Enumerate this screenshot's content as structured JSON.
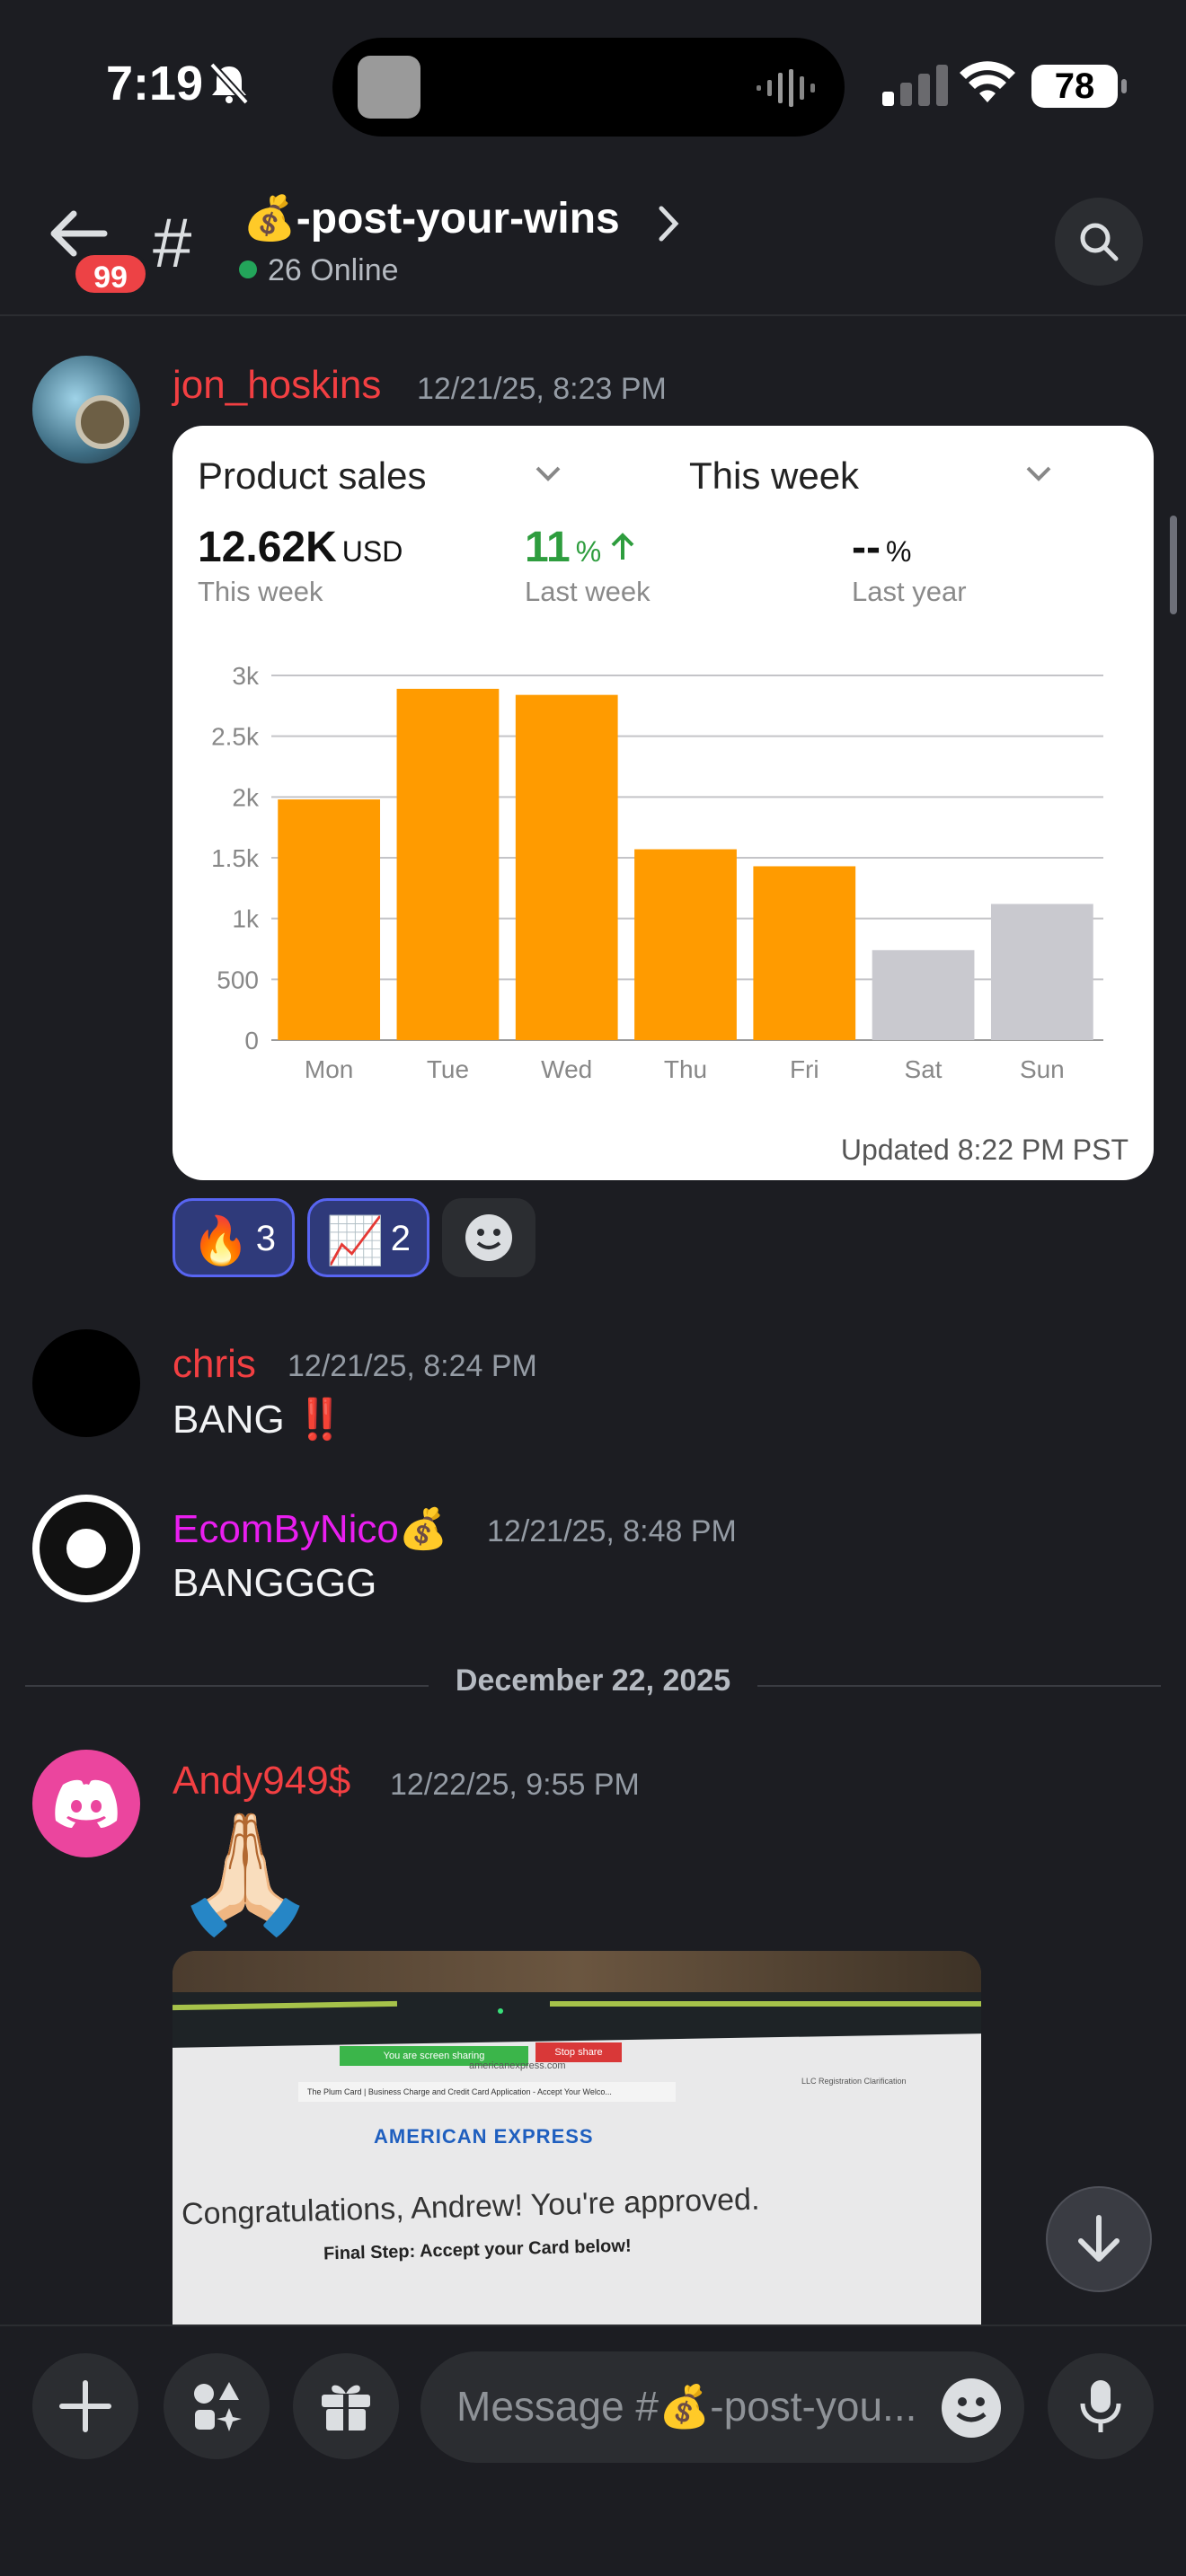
{
  "status_bar": {
    "time": "7:19",
    "battery": "78"
  },
  "header": {
    "back_badge": "99",
    "channel_name": "💰-post-your-wins",
    "online_text": "26 Online"
  },
  "messages": [
    {
      "author": "jon_hoskins",
      "author_color": "#f23f42",
      "timestamp": "12/21/25, 8:23 PM",
      "card": {
        "dropdown_metric": "Product sales",
        "dropdown_period": "This week",
        "kpis": [
          {
            "value": "12.62K",
            "unit": "USD",
            "label": "This week"
          },
          {
            "value": "11",
            "unit": "%",
            "label": "Last week",
            "trend": "up"
          },
          {
            "value": "--",
            "unit": "%",
            "label": "Last year"
          }
        ],
        "updated": "Updated 8:22 PM PST"
      },
      "reactions": [
        {
          "emoji": "🔥",
          "count": "3"
        },
        {
          "emoji": "📈",
          "count": "2"
        }
      ]
    },
    {
      "author": "chris",
      "author_color": "#f23f42",
      "timestamp": "12/21/25, 8:24 PM",
      "text": "BANG ‼️"
    },
    {
      "author": "EcomByNico💰",
      "author_color": "#e91ef0",
      "timestamp": "12/21/25, 8:48 PM",
      "text": "BANGGGG"
    },
    {
      "author": "Andy949$",
      "author_color": "#f23f42",
      "timestamp": "12/22/25, 9:55 PM",
      "text": "🙏🏻",
      "photo": {
        "share_bar": "You are screen sharing",
        "stop_share": "Stop share",
        "url": "americanexpress.com",
        "tab_title": "The Plum Card | Business Charge and Credit Card Application - Accept Your Welco...",
        "tab2_title": "LLC Registration Clarification",
        "brand": "AMERICAN EXPRESS",
        "headline": "Congratulations, Andrew! You're approved.",
        "subline": "Final Step: Accept your Card below!"
      }
    }
  ],
  "date_divider": "December 22, 2025",
  "composer": {
    "placeholder": "Message #💰-post-you..."
  },
  "chart_data": {
    "type": "bar",
    "categories": [
      "Mon",
      "Tue",
      "Wed",
      "Thu",
      "Fri",
      "Sat",
      "Sun"
    ],
    "values": [
      1980,
      2890,
      2840,
      1570,
      1430,
      740,
      1120
    ],
    "highlighted": [
      true,
      true,
      true,
      true,
      true,
      false,
      false
    ],
    "yticks": [
      "0",
      "500",
      "1k",
      "1.5k",
      "2k",
      "2.5k",
      "3k"
    ],
    "ylim": [
      0,
      3000
    ],
    "colors": {
      "active": "#ff9b00",
      "inactive": "#c9c9cf"
    },
    "grid": true
  }
}
